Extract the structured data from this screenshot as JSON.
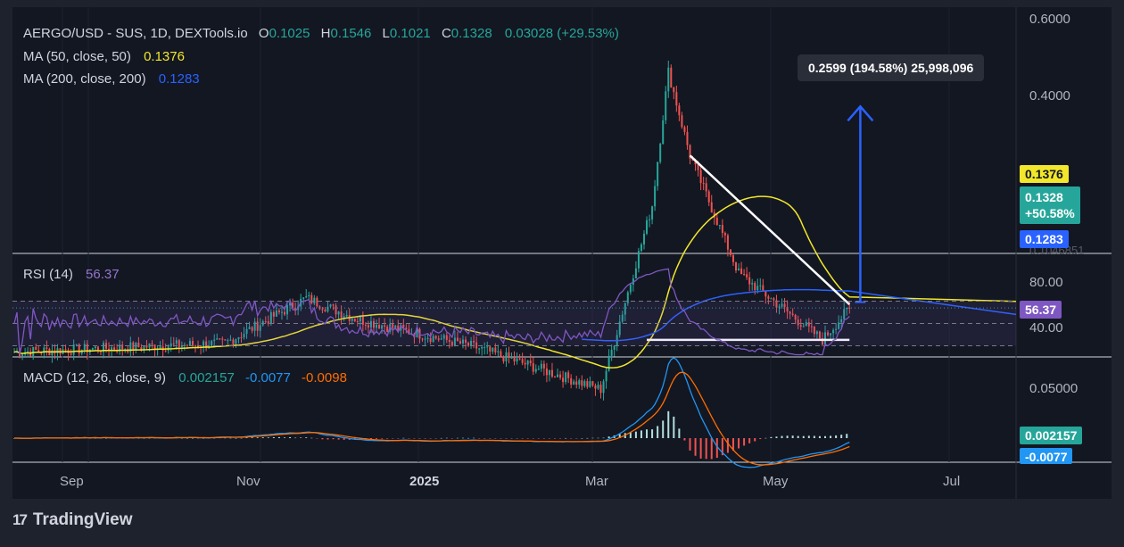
{
  "legend": {
    "symbol": "AERGO/USD - SUS, 1D, DEXTools.io",
    "o_label": "O",
    "o_val": "0.1025",
    "h_label": "H",
    "h_val": "0.1546",
    "l_label": "L",
    "l_val": "0.1021",
    "c_label": "C",
    "c_val": "0.1328",
    "change": "0.03028 (+29.53%)",
    "ma50_label": "MA (50, close, 50)",
    "ma50_val": "0.1376",
    "ma200_label": "MA (200, close, 200)",
    "ma200_val": "0.1283",
    "rsi_label": "RSI (14)",
    "rsi_val": "56.37",
    "macd_label": "MACD (12, 26, close, 9)",
    "macd_val": "0.002157",
    "signal_val": "-0.0077",
    "hist_val": "-0.0098"
  },
  "tooltip": "0.2599 (194.58%) 25,998,096",
  "price_axis": [
    "0.6000",
    "0.4000"
  ],
  "price_tags": {
    "ma50": "0.1376",
    "close": "0.1328",
    "pct": "+50.58%",
    "ma200": "0.1283",
    "hidden": "0.1046851"
  },
  "rsi_axis": [
    "80.00",
    "40.00"
  ],
  "rsi_tag": "56.37",
  "macd_axis": [
    "0.05000"
  ],
  "macd_tags": {
    "macd": "0.002157",
    "signal": "-0.0077"
  },
  "x_axis": [
    "Sep",
    "Nov",
    "2025",
    "Mar",
    "May",
    "Jul"
  ],
  "footer": "TradingView",
  "colors": {
    "up": "#26a69a",
    "down": "#ef5350",
    "ma50": "#f2e72b",
    "ma200": "#2962ff",
    "rsi": "#7e57c2",
    "macd": "#2196f3",
    "signal": "#ff6d00",
    "bg": "#131722"
  },
  "chart_data": {
    "type": "line",
    "title": "AERGO/USD - SUS, 1D, DEXTools.io",
    "price_key_points": [
      {
        "x": "2024-08-15",
        "close": 0.105
      },
      {
        "x": "2024-11-01",
        "close": 0.11
      },
      {
        "x": "2024-12-01",
        "close": 0.14
      },
      {
        "x": "2024-12-20",
        "close": 0.125
      },
      {
        "x": "2025-02-01",
        "close": 0.108
      },
      {
        "x": "2025-03-20",
        "close": 0.086
      },
      {
        "x": "2025-04-08",
        "close": 0.23
      },
      {
        "x": "2025-04-14",
        "close": 0.47
      },
      {
        "x": "2025-04-22",
        "close": 0.3
      },
      {
        "x": "2025-05-10",
        "close": 0.16
      },
      {
        "x": "2025-06-10",
        "close": 0.112
      },
      {
        "x": "2025-06-20",
        "close": 0.1328
      }
    ],
    "series": [
      {
        "name": "MA (50, close, 50)",
        "last": 0.1376
      },
      {
        "name": "MA (200, close, 200)",
        "last": 0.1283
      },
      {
        "name": "RSI (14)",
        "last": 56.37
      },
      {
        "name": "MACD (12, 26, close, 9)",
        "last": 0.002157
      }
    ],
    "ylim": [
      0.06,
      0.6
    ],
    "rsi_ylim": [
      20,
      100
    ],
    "grid": true
  }
}
